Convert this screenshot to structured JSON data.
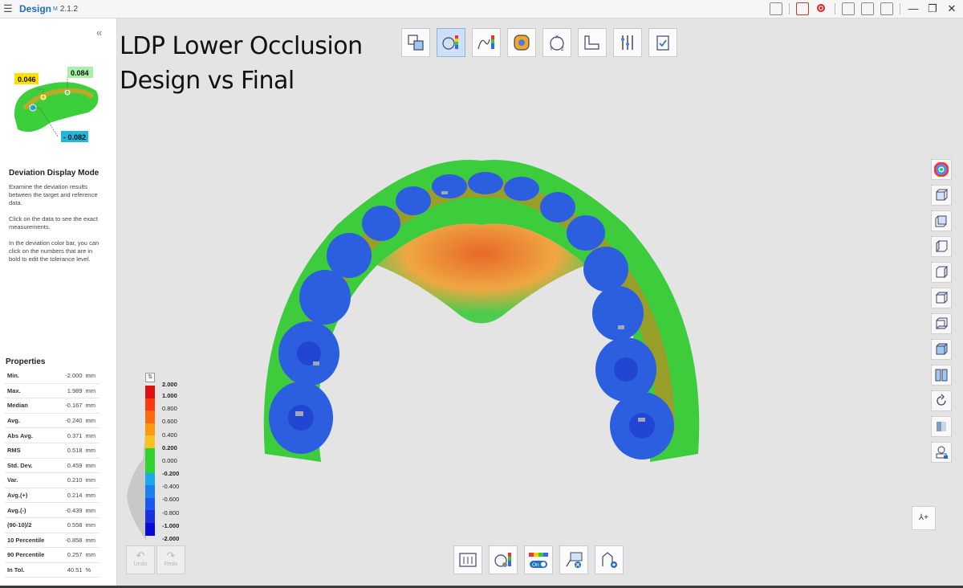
{
  "titlebar": {
    "app_name": "Design",
    "app_sup": "M",
    "version": "2.1.2"
  },
  "left_panel": {
    "preview": {
      "value_top_left": "0.046",
      "value_top_right": "0.084",
      "value_bottom": "- 0.082"
    },
    "mode_title": "Deviation Display Mode",
    "mode_desc": [
      "Examine the deviation results between the target and reference data.",
      "Click on the data to see the exact measurements.",
      "In the deviation color bar, you can click on the numbers that are in bold to edit the tolerance level."
    ],
    "properties_title": "Properties",
    "properties": [
      {
        "name": "Min.",
        "value": "-2.000",
        "unit": "mm"
      },
      {
        "name": "Max.",
        "value": "1.989",
        "unit": "mm"
      },
      {
        "name": "Median",
        "value": "-0.167",
        "unit": "mm"
      },
      {
        "name": "Avg.",
        "value": "-0.240",
        "unit": "mm"
      },
      {
        "name": "Abs Avg.",
        "value": "0.371",
        "unit": "mm"
      },
      {
        "name": "RMS",
        "value": "0.518",
        "unit": "mm"
      },
      {
        "name": "Std. Dev.",
        "value": "0.459",
        "unit": "mm"
      },
      {
        "name": "Var.",
        "value": "0.210",
        "unit": "mm"
      },
      {
        "name": "Avg.(+)",
        "value": "0.214",
        "unit": "mm"
      },
      {
        "name": "Avg.(-)",
        "value": "-0.439",
        "unit": "mm"
      },
      {
        "name": "(90-10)/2",
        "value": "0.558",
        "unit": "mm"
      },
      {
        "name": "10 Percentile",
        "value": "-0.858",
        "unit": "mm"
      },
      {
        "name": "90 Percentile",
        "value": "0.257",
        "unit": "mm"
      },
      {
        "name": "In Tol.",
        "value": "40.51",
        "unit": "%"
      }
    ],
    "undo_label": "Undo",
    "redo_label": "Redo"
  },
  "canvas": {
    "title_line1": "LDP Lower Occlusion",
    "title_line2": "Design vs Final"
  },
  "colorbar": {
    "labels": [
      {
        "text": "2.000",
        "bold": true
      },
      {
        "text": "1.000",
        "bold": true
      },
      {
        "text": "0.800",
        "bold": false
      },
      {
        "text": "0.600",
        "bold": false
      },
      {
        "text": "0.400",
        "bold": false
      },
      {
        "text": "0.200",
        "bold": true
      },
      {
        "text": "0.000",
        "bold": false
      },
      {
        "text": "-0.200",
        "bold": true
      },
      {
        "text": "-0.400",
        "bold": false
      },
      {
        "text": "-0.600",
        "bold": false
      },
      {
        "text": "-0.800",
        "bold": false
      },
      {
        "text": "-1.000",
        "bold": true
      },
      {
        "text": "-2.000",
        "bold": true
      }
    ],
    "segment_colors": [
      "#e01010",
      "#ff3a10",
      "#ff6a10",
      "#ff9a10",
      "#ffc020",
      "#2fd22f",
      "#2fd22f",
      "#1aa8f0",
      "#1a80f0",
      "#1a58f0",
      "#1a30e0",
      "#0a0ad8"
    ]
  },
  "nav_label": "⅄+",
  "bottom_toggle_label": "On"
}
